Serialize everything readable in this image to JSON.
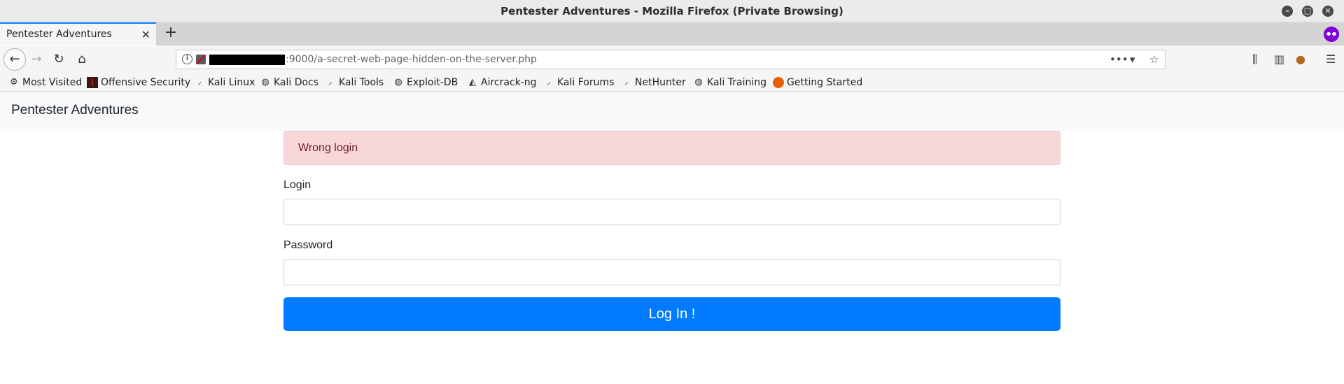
{
  "window": {
    "title": "Pentester Adventures - Mozilla Firefox (Private Browsing)"
  },
  "tabs": [
    {
      "title": "Pentester Adventures"
    }
  ],
  "urlbar": {
    "url_visible": ":9000/a-secret-web-page-hidden-on-the-server.php"
  },
  "bookmarks": [
    {
      "label": "Most Visited",
      "icon": "gear-icon"
    },
    {
      "label": "Offensive Security",
      "icon": "offsec-icon"
    },
    {
      "label": "Kali Linux",
      "icon": "kali-dragon-icon"
    },
    {
      "label": "Kali Docs",
      "icon": "globe-icon"
    },
    {
      "label": "Kali Tools",
      "icon": "kali-dragon-icon"
    },
    {
      "label": "Exploit-DB",
      "icon": "globe-icon"
    },
    {
      "label": "Aircrack-ng",
      "icon": "aircrack-icon"
    },
    {
      "label": "Kali Forums",
      "icon": "kali-dragon-icon"
    },
    {
      "label": "NetHunter",
      "icon": "kali-dragon-icon"
    },
    {
      "label": "Kali Training",
      "icon": "globe-icon"
    },
    {
      "label": "Getting Started",
      "icon": "firefox-icon"
    }
  ],
  "page": {
    "brand": "Pentester Adventures",
    "alert": "Wrong login",
    "login_label": "Login",
    "login_value": "",
    "password_label": "Password",
    "password_value": "",
    "submit_label": "Log In !"
  },
  "colors": {
    "primary": "#007bff",
    "alert_bg": "#f8d7da",
    "alert_text": "#721c24",
    "private_browsing": "#8000d7"
  }
}
